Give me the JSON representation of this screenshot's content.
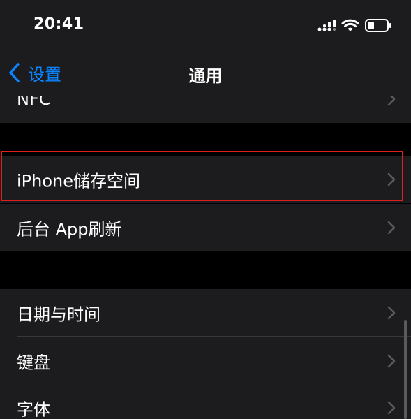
{
  "status_bar": {
    "time": "20:41",
    "icons": [
      "cell-signal-icon",
      "wifi-icon",
      "battery-icon"
    ]
  },
  "nav": {
    "back_label": "设置",
    "title": "通用"
  },
  "rows": {
    "nfc": "NFC",
    "iphone_storage": "iPhone储存空间",
    "background_refresh": "后台 App刷新",
    "date_time": "日期与时间",
    "keyboard": "键盘",
    "fonts": "字体"
  },
  "colors": {
    "accent": "#0a84ff",
    "background": "#000000",
    "cell": "#1c1c1e",
    "highlight": "#e02020"
  }
}
